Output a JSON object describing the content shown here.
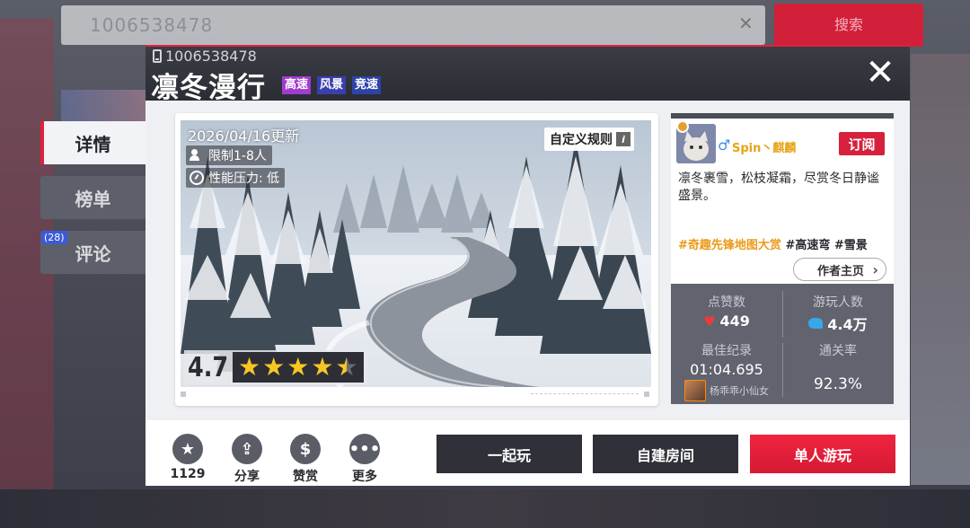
{
  "background": {
    "search_text": "1006538478",
    "search_button": "搜索"
  },
  "side_tabs": {
    "details": "详情",
    "rankings": "榜单",
    "comments": "评论",
    "comment_count": "(28)"
  },
  "header": {
    "map_id": "1006538478",
    "title": "凛冬漫行",
    "tags": [
      "高速",
      "风景",
      "竞速"
    ]
  },
  "preview": {
    "updated": "2026/04/16更新",
    "players": "限制1-8人",
    "performance": "性能压力: 低",
    "custom_rules": "自定义规则",
    "rating": "4.7",
    "stars": 4.5
  },
  "author": {
    "name": "Spin丶麒麟",
    "subscribe": "订阅",
    "description": "凛冬裹雪，松枝凝霜，尽赏冬日静谧盛景。",
    "hashtags": [
      "#奇趣先锋地图大赏",
      "#高速弯",
      "#雪景"
    ],
    "home_button": "作者主页"
  },
  "stats": {
    "likes_label": "点赞数",
    "likes": "449",
    "players_label": "游玩人数",
    "players": "4.4万",
    "best_label": "最佳纪录",
    "best_time": "01:04.695",
    "record_holder": "杨乖乖小仙女",
    "clear_label": "通关率",
    "clear_rate": "92.3%"
  },
  "actions": {
    "favorites": "1129",
    "share": "分享",
    "reward": "赞赏",
    "more": "更多"
  },
  "buttons": {
    "together": "一起玩",
    "create_room": "自建房间",
    "solo": "单人游玩"
  },
  "colors": {
    "accent": "#e0213e",
    "star": "#f7c623",
    "author_name": "#e6a417"
  }
}
